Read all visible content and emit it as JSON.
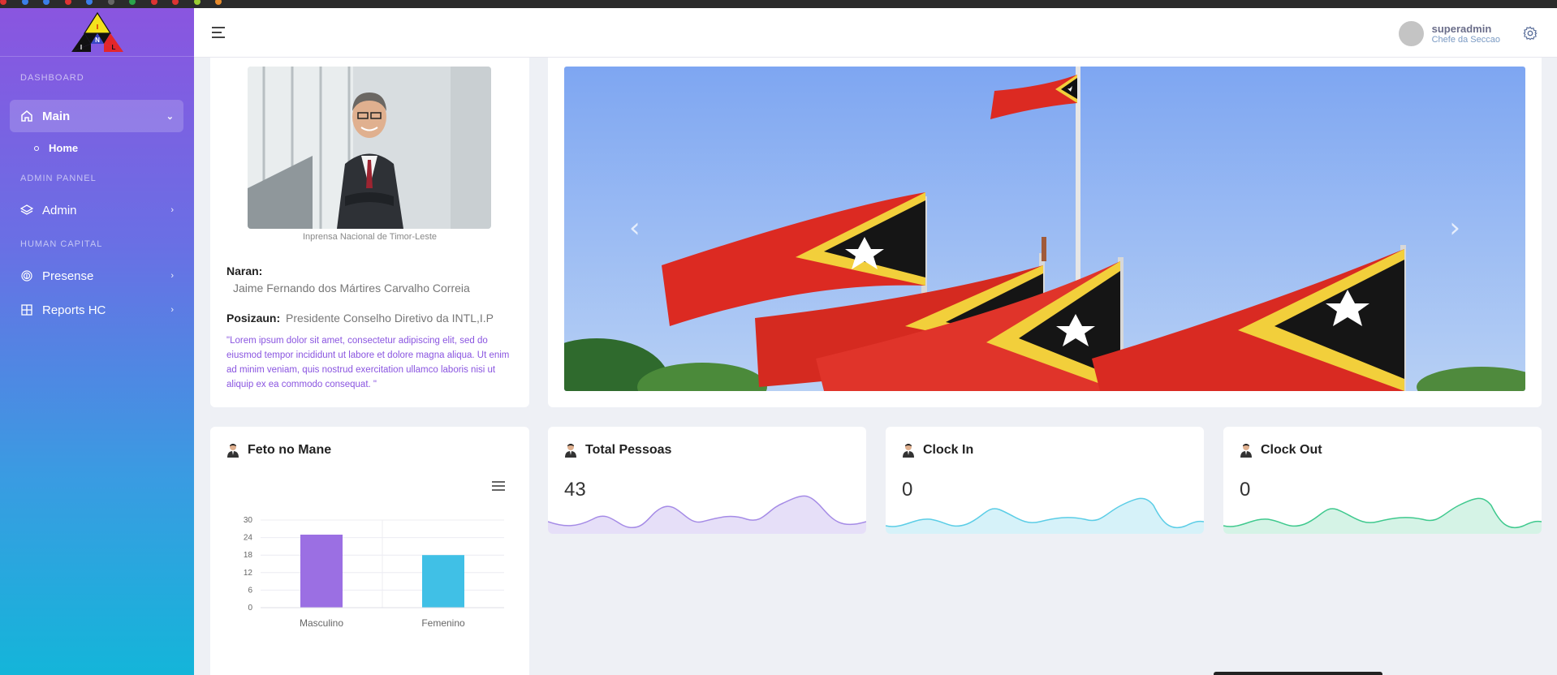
{
  "sidebar": {
    "logo_letters": [
      "I",
      "N",
      "I",
      "L"
    ],
    "sections": {
      "dashboard": "DASHBOARD",
      "admin": "ADMIN PANNEL",
      "human_capital": "HUMAN CAPITAL"
    },
    "items": {
      "main": "Main",
      "home": "Home",
      "admin": "Admin",
      "presense": "Presense",
      "reports": "Reports HC"
    }
  },
  "header": {
    "user_name": "superadmin",
    "user_role": "Chefe da Seccao"
  },
  "profile": {
    "caption": "Inprensa Nacional de Timor-Leste",
    "name_label": "Naran:",
    "name_value": "Jaime Fernando dos Mártires Carvalho Correia",
    "position_label": "Posizaun:",
    "position_value": "Presidente Conselho Diretivo da INTL,I.P",
    "quote": "\"Lorem ipsum dolor sit amet, consectetur adipiscing elit, sed do eiusmod tempor incididunt ut labore et dolore magna aliqua. Ut enim ad minim veniam, quis nostrud exercitation ullamco laboris nisi ut aliquip ex ea commodo consequat. \""
  },
  "carousel": {
    "prev": "‹",
    "next": "›"
  },
  "gender_card": {
    "title": "Feto no Mane"
  },
  "stats": {
    "total": {
      "title": "Total Pessoas",
      "value": "43",
      "color": "#a58be6"
    },
    "clock_in": {
      "title": "Clock In",
      "value": "0",
      "color": "#5bcde6"
    },
    "clock_out": {
      "title": "Clock Out",
      "value": "0",
      "color": "#3fc98e"
    }
  },
  "chart_data": {
    "type": "bar",
    "categories": [
      "Masculino",
      "Femenino"
    ],
    "values": [
      25,
      18
    ],
    "colors": [
      "#9b6fe3",
      "#40c0e6"
    ],
    "ylim": [
      0,
      30
    ],
    "yticks": [
      0,
      6,
      12,
      18,
      24,
      30
    ],
    "grid": true,
    "title": "",
    "xlabel": "",
    "ylabel": ""
  }
}
